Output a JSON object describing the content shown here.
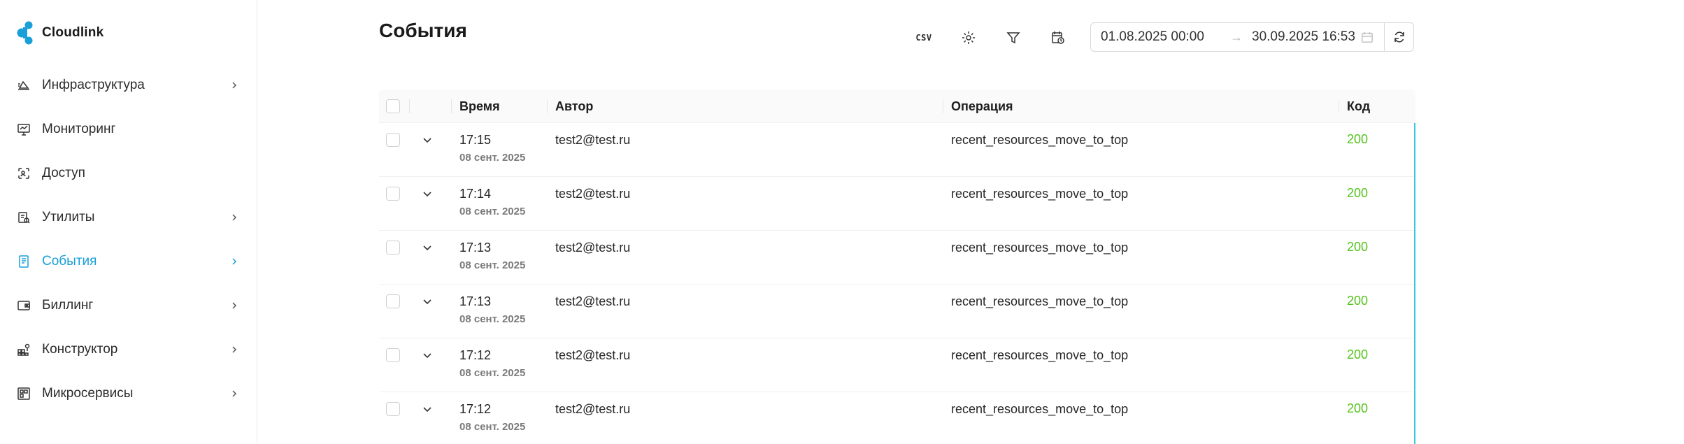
{
  "app": {
    "name": "Cloudlink"
  },
  "sidebar": {
    "items": [
      {
        "label": "Инфраструктура",
        "icon": "infrastructure-icon",
        "has_children": true,
        "active": false
      },
      {
        "label": "Мониторинг",
        "icon": "monitor-icon",
        "has_children": false,
        "active": false
      },
      {
        "label": "Доступ",
        "icon": "access-icon",
        "has_children": false,
        "active": false
      },
      {
        "label": "Утилиты",
        "icon": "utilities-icon",
        "has_children": true,
        "active": false
      },
      {
        "label": "События",
        "icon": "events-icon",
        "has_children": true,
        "active": true
      },
      {
        "label": "Биллинг",
        "icon": "billing-icon",
        "has_children": true,
        "active": false
      },
      {
        "label": "Конструктор",
        "icon": "constructor-icon",
        "has_children": true,
        "active": false
      },
      {
        "label": "Микросервисы",
        "icon": "microservices-icon",
        "has_children": true,
        "active": false
      }
    ]
  },
  "page": {
    "title": "События"
  },
  "toolbar": {
    "csv_label": "CSV",
    "date_from": "01.08.2025 00:00",
    "date_arrow": "→",
    "date_to": "30.09.2025 16:53"
  },
  "table": {
    "columns": {
      "time": "Время",
      "author": "Автор",
      "operation": "Операция",
      "code": "Код"
    },
    "rows": [
      {
        "time": "17:15",
        "date": "08 сент. 2025",
        "author": "test2@test.ru",
        "operation": "recent_resources_move_to_top",
        "code": "200"
      },
      {
        "time": "17:14",
        "date": "08 сент. 2025",
        "author": "test2@test.ru",
        "operation": "recent_resources_move_to_top",
        "code": "200"
      },
      {
        "time": "17:13",
        "date": "08 сент. 2025",
        "author": "test2@test.ru",
        "operation": "recent_resources_move_to_top",
        "code": "200"
      },
      {
        "time": "17:13",
        "date": "08 сент. 2025",
        "author": "test2@test.ru",
        "operation": "recent_resources_move_to_top",
        "code": "200"
      },
      {
        "time": "17:12",
        "date": "08 сент. 2025",
        "author": "test2@test.ru",
        "operation": "recent_resources_move_to_top",
        "code": "200"
      },
      {
        "time": "17:12",
        "date": "08 сент. 2025",
        "author": "test2@test.ru",
        "operation": "recent_resources_move_to_top",
        "code": "200"
      }
    ]
  },
  "colors": {
    "accent": "#1a9fd8",
    "success": "#52c41a",
    "selection_bar": "#37c8df"
  }
}
